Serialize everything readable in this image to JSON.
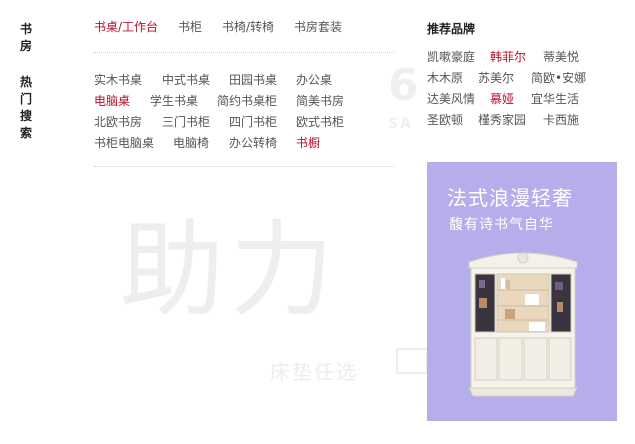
{
  "category": {
    "label": "书房",
    "links": [
      {
        "text": "书桌/工作台",
        "hot": true
      },
      {
        "text": "书柜",
        "hot": false
      },
      {
        "text": "书椅/转椅",
        "hot": false
      },
      {
        "text": "书房套装",
        "hot": false
      }
    ]
  },
  "hot_search": {
    "label": "热门搜索",
    "rows": [
      [
        {
          "text": "实木书桌",
          "hot": false
        },
        {
          "text": "中式书桌",
          "hot": false
        },
        {
          "text": "田园书桌",
          "hot": false
        },
        {
          "text": "办公桌",
          "hot": false
        }
      ],
      [
        {
          "text": "电脑桌",
          "hot": true
        },
        {
          "text": "学生书桌",
          "hot": false
        },
        {
          "text": "简约书桌柜",
          "hot": false
        },
        {
          "text": "简美书房",
          "hot": false
        }
      ],
      [
        {
          "text": "北欧书房",
          "hot": false
        },
        {
          "text": "三门书柜",
          "hot": false
        },
        {
          "text": "四门书柜",
          "hot": false
        },
        {
          "text": "欧式书柜",
          "hot": false
        }
      ],
      [
        {
          "text": "书柜电脑桌",
          "hot": false
        },
        {
          "text": "电脑椅",
          "hot": false
        },
        {
          "text": "办公转椅",
          "hot": false
        },
        {
          "text": "书橱",
          "hot": true
        }
      ]
    ]
  },
  "brands": {
    "title": "推荐品牌",
    "rows": [
      [
        {
          "text": "凯嗽豪庭",
          "hot": false
        },
        {
          "text": "韩菲尔",
          "hot": true
        },
        {
          "text": "蒂美悦",
          "hot": false
        }
      ],
      [
        {
          "text": "木木原",
          "hot": false
        },
        {
          "text": "苏美尔",
          "hot": false
        },
        {
          "text": "简欧•安娜",
          "hot": false
        }
      ],
      [
        {
          "text": "达美风情",
          "hot": false
        },
        {
          "text": "慕娅",
          "hot": true
        },
        {
          "text": "宜华生活",
          "hot": false
        }
      ],
      [
        {
          "text": "圣欧顿",
          "hot": false
        },
        {
          "text": "槿秀家园",
          "hot": false
        },
        {
          "text": "卡西施",
          "hot": false
        }
      ]
    ]
  },
  "promo": {
    "headline": "法式浪漫轻奢",
    "subline": "馥有诗书气自华",
    "bg_color": "#b6aeea"
  },
  "watermark": {
    "big_text": "助力",
    "small_text": "床垫任选",
    "logo_num": "6",
    "logo_text": "SA"
  },
  "colors": {
    "hot_link": "#b8102a",
    "link": "#555555",
    "heading": "#222222"
  }
}
